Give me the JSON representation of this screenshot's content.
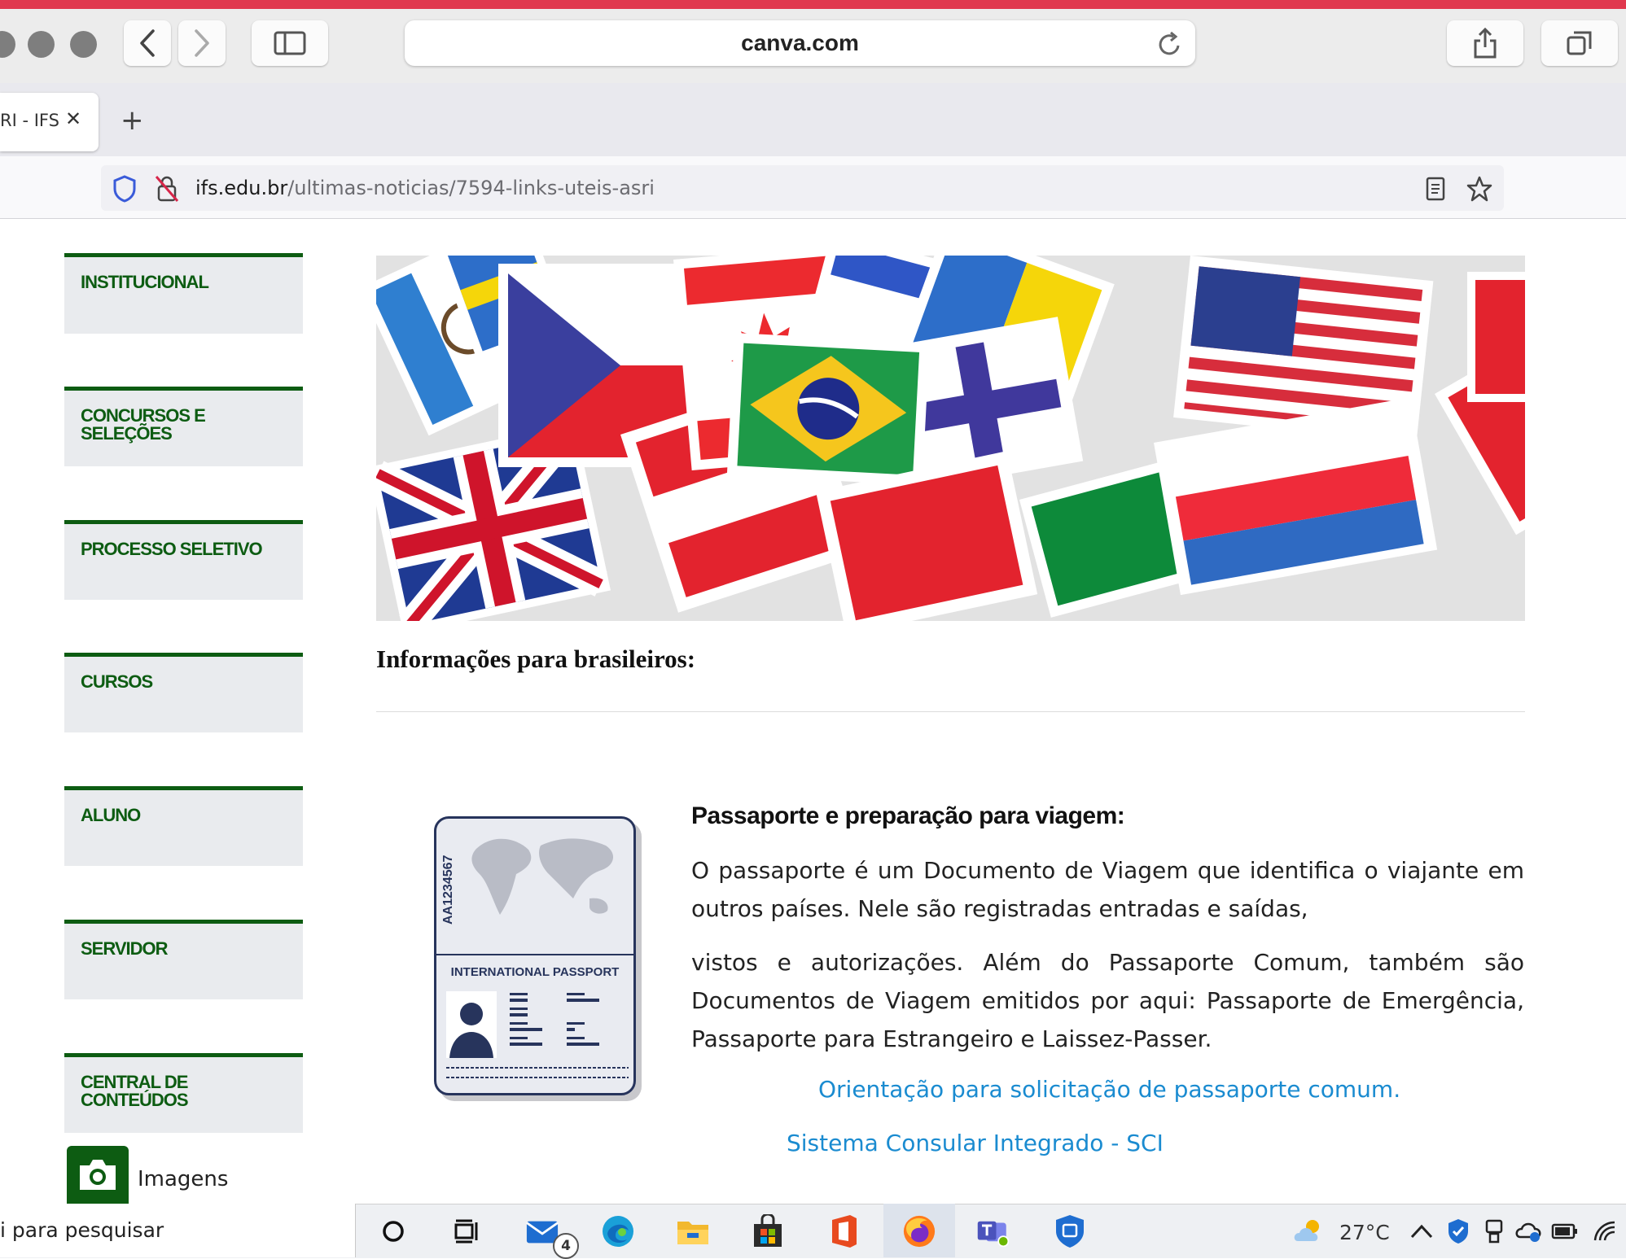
{
  "safari": {
    "address": "canva.com"
  },
  "firefox": {
    "tab_title": "RI - IFS",
    "tab_close": "✕",
    "new_tab": "+",
    "url_domain": "ifs.edu.br",
    "url_path": "/ultimas-noticias/7594-links-uteis-asri"
  },
  "sidebar": {
    "items": [
      {
        "label": "INSTITUCIONAL"
      },
      {
        "label": "CONCURSOS E SELEÇÕES"
      },
      {
        "label": "PROCESSO SELETIVO"
      },
      {
        "label": "CURSOS"
      },
      {
        "label": "ALUNO"
      },
      {
        "label": "SERVIDOR"
      },
      {
        "label": "CENTRAL DE CONTEÚDOS"
      }
    ],
    "images_label": "Imagens"
  },
  "main": {
    "heading": "Informações para brasileiros:",
    "card_title": "Passaporte e preparação para viagem:",
    "paragraph_1": "O passaporte é um Documento de Viagem que identifica o viajante em outros países. Nele são registradas entradas e saídas,",
    "paragraph_2": "vistos e autorizações. Além do Passaporte Comum, também são Documentos de Viagem emitidos por aqui: Passaporte de Emergência, Passaporte para Estrangeiro e Laissez-Passer.",
    "link_1": "Orientação para solicitação de passaporte comum.",
    "link_2": "Sistema Consular Integrado - SCI"
  },
  "passport": {
    "number": "AA1234567",
    "title": "INTERNATIONAL PASSPORT"
  },
  "taskbar": {
    "search_placeholder": "i para pesquisar",
    "mail_badge": "4",
    "temperature": "27°C"
  },
  "colors": {
    "sidebar_green": "#0d5c12",
    "link_blue": "#1a8bd0",
    "safari_accent": "#e0384e"
  }
}
